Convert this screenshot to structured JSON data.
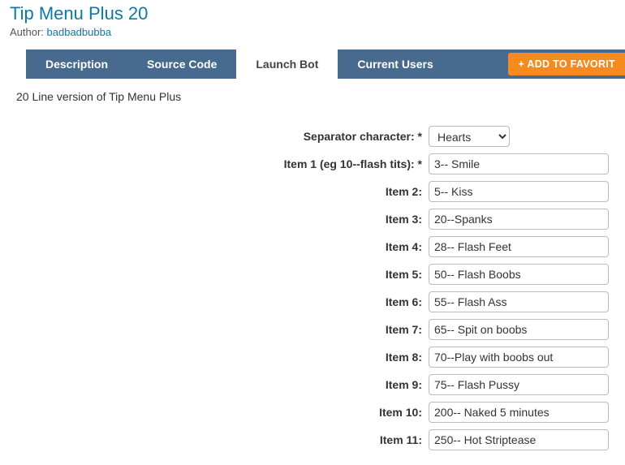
{
  "title": "Tip Menu Plus 20",
  "author_label": "Author: ",
  "author": "badbadbubba",
  "tabs": [
    "Description",
    "Source Code",
    "Launch Bot",
    "Current Users"
  ],
  "active_tab_index": 2,
  "fav_button": "+ ADD TO FAVORIT",
  "description": "20 Line version of Tip Menu Plus",
  "separator": {
    "label": "Separator character: *",
    "value": "Hearts"
  },
  "items": [
    {
      "label": "Item 1 (eg 10--flash tits): *",
      "value": "3-- Smile"
    },
    {
      "label": "Item 2:",
      "value": "5-- Kiss"
    },
    {
      "label": "Item 3:",
      "value": "20--Spanks"
    },
    {
      "label": "Item 4:",
      "value": "28-- Flash Feet"
    },
    {
      "label": "Item 5:",
      "value": "50-- Flash Boobs"
    },
    {
      "label": "Item 6:",
      "value": "55-- Flash Ass"
    },
    {
      "label": "Item 7:",
      "value": "65-- Spit on boobs"
    },
    {
      "label": "Item 8:",
      "value": "70--Play with boobs out"
    },
    {
      "label": "Item 9:",
      "value": "75-- Flash Pussy"
    },
    {
      "label": "Item 10:",
      "value": "200-- Naked 5 minutes"
    },
    {
      "label": "Item 11:",
      "value": "250-- Hot Striptease"
    }
  ]
}
